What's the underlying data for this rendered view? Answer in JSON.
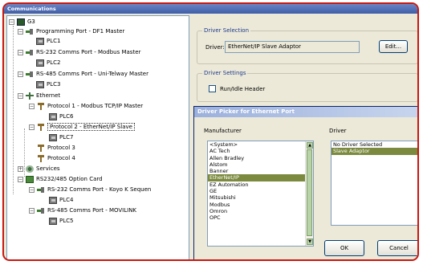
{
  "window": {
    "title": "Communications"
  },
  "tree": {
    "root": "G3",
    "items": [
      {
        "label": "Programming Port - DF1 Master"
      },
      {
        "label": "PLC1"
      },
      {
        "label": "RS-232 Comms Port - Modbus Master"
      },
      {
        "label": "PLC2"
      },
      {
        "label": "RS-485 Comms Port - Uni-Telway Master"
      },
      {
        "label": "PLC3"
      },
      {
        "label": "Ethernet"
      },
      {
        "label": "Protocol 1 - Modbus TCP/IP Master"
      },
      {
        "label": "PLC6"
      },
      {
        "label": "Protocol 2 - EtherNet/IP Slave"
      },
      {
        "label": "PLC7"
      },
      {
        "label": "Protocol 3"
      },
      {
        "label": "Protocol 4"
      },
      {
        "label": "Services"
      },
      {
        "label": "RS232/485 Option Card"
      },
      {
        "label": "RS-232 Comms Port - Koyo K Sequen"
      },
      {
        "label": "PLC4"
      },
      {
        "label": "RS-485 Comms Port - MOVILINK"
      },
      {
        "label": "PLC5"
      }
    ]
  },
  "driver_selection": {
    "group_title": "Driver Selection",
    "driver_label": "Driver:",
    "driver_value": "EtherNet/IP Slave Adaptor",
    "edit_button": "Edit..."
  },
  "driver_settings": {
    "group_title": "Driver Settings",
    "run_idle_label": "Run/Idle Header",
    "run_idle_checked": false
  },
  "dialog": {
    "title": "Driver Picker for Ethernet Port",
    "manufacturer_label": "Manufacturer",
    "driver_label": "Driver",
    "manufacturers": [
      "<System>",
      "AC Tech",
      "Allen Bradley",
      "Alstom",
      "Banner",
      "EtherNet/IP",
      "EZ Automation",
      "GE",
      "Mitsubishi",
      "Modbus",
      "Omron",
      "OPC"
    ],
    "selected_manufacturer": "EtherNet/IP",
    "drivers": [
      "No Driver Selected",
      "Slave Adaptor"
    ],
    "selected_driver": "Slave Adaptor",
    "ok_button": "OK",
    "cancel_button": "Cancel"
  },
  "colors": {
    "accent_frame": "#c81810",
    "selection": "#7b8a3f",
    "titlebar": "#3f5ea8"
  }
}
